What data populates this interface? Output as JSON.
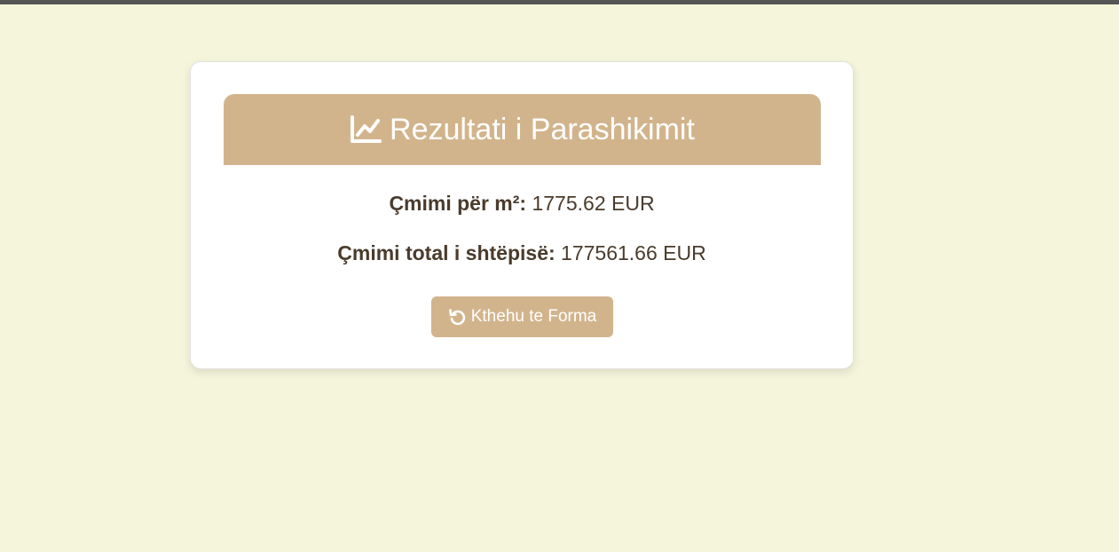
{
  "colors": {
    "background": "#f5f5dc",
    "accent": "#d2b48c",
    "text": "#4a3b2c",
    "card": "#ffffff"
  },
  "result": {
    "title_icon": "chart-line-icon",
    "title": "Rezultati i Parashikimit",
    "price_per_m2_label": "Çmimi për m²:",
    "price_per_m2_value": "1775.62 EUR",
    "total_price_label": "Çmimi total i shtëpisë:",
    "total_price_value": "177561.66 EUR"
  },
  "actions": {
    "back_icon": "undo-icon",
    "back_label": "Kthehu te Forma"
  }
}
